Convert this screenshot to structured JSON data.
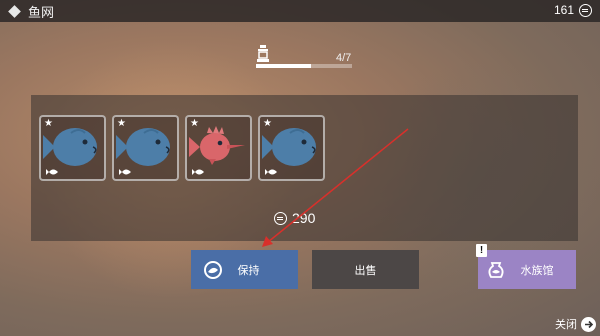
{
  "header": {
    "title": "鱼网",
    "coins": "161"
  },
  "capacity": {
    "text": "4/7",
    "fill_fraction": 0.57
  },
  "slots": [
    {
      "species": "blue-fish",
      "stars": "★"
    },
    {
      "species": "blue-fish",
      "stars": "★"
    },
    {
      "species": "red-spiny-fish",
      "stars": "★"
    },
    {
      "species": "blue-fish",
      "stars": "★"
    }
  ],
  "total_value": "290",
  "buttons": {
    "keep": "保持",
    "sell": "出售",
    "aquarium": "水族馆",
    "alert": "!"
  },
  "close_label": "关闭",
  "colors": {
    "keep": "#4a6ea7",
    "sell": "#4c4746",
    "aquarium": "#9b84c5",
    "arrow": "#d8302b"
  }
}
